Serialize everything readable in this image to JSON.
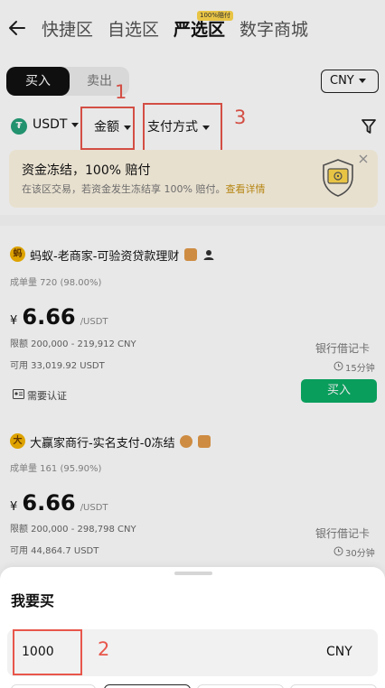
{
  "nav": {
    "tabs": [
      "快捷区",
      "自选区",
      "严选区",
      "数字商城"
    ],
    "active_tab": "严选区",
    "badge": "100%赔付"
  },
  "trade": {
    "buy_label": "买入",
    "sell_label": "卖出",
    "currency": "CNY"
  },
  "filters": {
    "coin": "USDT",
    "amount": "金额",
    "payment": "支付方式"
  },
  "annotations": [
    "1",
    "2",
    "3"
  ],
  "banner": {
    "title": "资金冻结，100% 赔付",
    "desc": "在该区交易，若资金发生冻结享 100% 赔付。",
    "link": "查看详情"
  },
  "listings": [
    {
      "avatar": "蚂",
      "name": "蚂蚁-老商家-可验资贷款理财",
      "stats": "成单量 720 (98.00%)",
      "price_symbol": "¥",
      "price": "6.66",
      "price_unit": "/USDT",
      "limit": "限额 200,000 - 219,912 CNY",
      "available": "可用 33,019.92 USDT",
      "payment": "银行借记卡",
      "time": "15分钟",
      "action": "买入",
      "kyc": "需要认证"
    },
    {
      "avatar": "大",
      "name": "大赢家商行-实名支付-0冻结",
      "stats": "成单量 161 (95.90%)",
      "price_symbol": "¥",
      "price": "6.66",
      "price_unit": "/USDT",
      "limit": "限额 200,000 - 298,798 CNY",
      "available": "可用 44,864.7 USDT",
      "payment": "银行借记卡",
      "time": "30分钟"
    }
  ],
  "sheet": {
    "title": "我要买",
    "amount": "1000",
    "currency": "CNY"
  },
  "colors": {
    "accent": "#0aae66",
    "annotation": "#e8564b",
    "banner_bg": "#fff7e4"
  }
}
